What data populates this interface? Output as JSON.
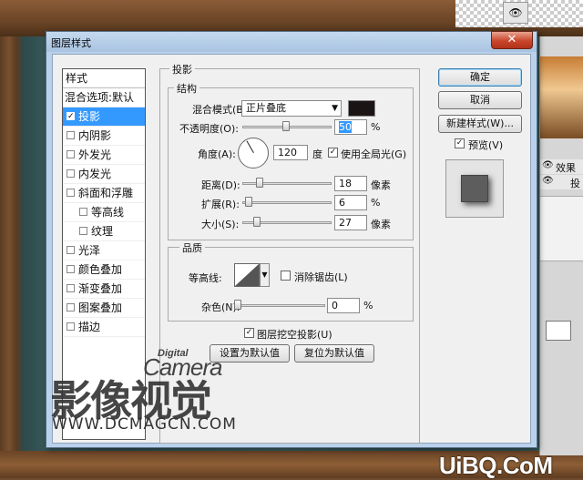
{
  "dialog": {
    "title": "图层样式",
    "close_label": "✕"
  },
  "style_list": {
    "header": "样式",
    "items": [
      {
        "label": "混合选项:默认",
        "checkbox": false,
        "checked": false,
        "selected": false
      },
      {
        "label": "投影",
        "checkbox": true,
        "checked": true,
        "selected": true
      },
      {
        "label": "内阴影",
        "checkbox": true,
        "checked": false,
        "selected": false
      },
      {
        "label": "外发光",
        "checkbox": true,
        "checked": false,
        "selected": false
      },
      {
        "label": "内发光",
        "checkbox": true,
        "checked": false,
        "selected": false
      },
      {
        "label": "斜面和浮雕",
        "checkbox": true,
        "checked": false,
        "selected": false
      },
      {
        "label": "等高线",
        "checkbox": true,
        "checked": false,
        "selected": false,
        "indent": true
      },
      {
        "label": "纹理",
        "checkbox": true,
        "checked": false,
        "selected": false,
        "indent": true
      },
      {
        "label": "光泽",
        "checkbox": true,
        "checked": false,
        "selected": false
      },
      {
        "label": "颜色叠加",
        "checkbox": true,
        "checked": false,
        "selected": false
      },
      {
        "label": "渐变叠加",
        "checkbox": true,
        "checked": false,
        "selected": false
      },
      {
        "label": "图案叠加",
        "checkbox": true,
        "checked": false,
        "selected": false
      },
      {
        "label": "描边",
        "checkbox": true,
        "checked": false,
        "selected": false
      }
    ]
  },
  "drop_shadow": {
    "group_title": "投影",
    "structure": {
      "title": "结构",
      "blend_mode_label": "混合模式(B):",
      "blend_mode_value": "正片叠底",
      "shadow_color": "#1a1414",
      "opacity_label": "不透明度(O):",
      "opacity_value": "50",
      "opacity_unit": "%",
      "angle_label": "角度(A):",
      "angle_value": "120",
      "angle_unit": "度",
      "global_light_label": "使用全局光(G)",
      "global_light_checked": true,
      "distance_label": "距离(D):",
      "distance_value": "18",
      "distance_unit": "像素",
      "spread_label": "扩展(R):",
      "spread_value": "6",
      "spread_unit": "%",
      "size_label": "大小(S):",
      "size_value": "27",
      "size_unit": "像素"
    },
    "quality": {
      "title": "品质",
      "contour_label": "等高线:",
      "anti_alias_label": "消除锯齿(L)",
      "anti_alias_checked": false,
      "noise_label": "杂色(N):",
      "noise_value": "0",
      "noise_unit": "%"
    },
    "knockout_label": "图层挖空投影(U)",
    "knockout_checked": true,
    "make_default_label": "设置为默认值",
    "reset_default_label": "复位为默认值"
  },
  "actions": {
    "ok_label": "确定",
    "cancel_label": "取消",
    "new_style_label": "新建样式(W)...",
    "preview_label": "预览(V)",
    "preview_checked": true
  },
  "layers_panel": {
    "effects_label": "效果",
    "shadow_label": "投"
  },
  "watermark": {
    "digital": "Digital",
    "camera": "Camera",
    "chinese": "影像视觉",
    "url": "WWW.DCMAGCN.COM",
    "logo": "UiBQ.CoM"
  }
}
